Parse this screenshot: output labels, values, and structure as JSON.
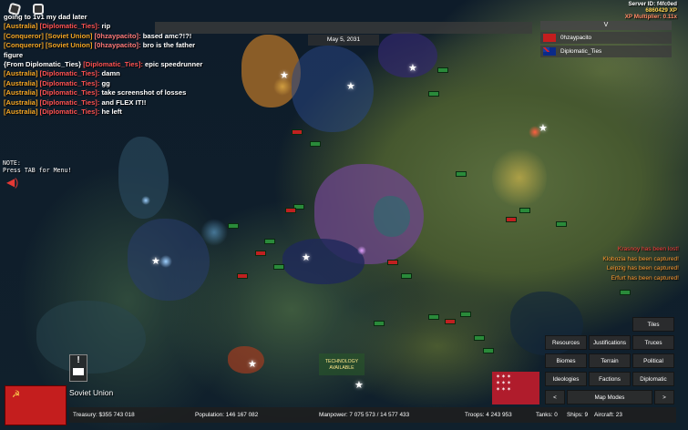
{
  "chat": [
    {
      "segments": [
        {
          "t": "going to 1v1 my dad later",
          "c": "tag-from"
        }
      ]
    },
    {
      "segments": [
        {
          "t": "[Australia] ",
          "c": "tag-au"
        },
        {
          "t": "[Diplomatic_Ties]:",
          "c": "tag-dt"
        },
        {
          "t": "  rip",
          "c": "tag-from"
        }
      ]
    },
    {
      "segments": [
        {
          "t": "[Conqueror] [Soviet Union] ",
          "c": "tag-cq"
        },
        {
          "t": "[0hzaypacito]:",
          "c": "tag-oz"
        },
        {
          "t": "  based amc?!?!",
          "c": "tag-from"
        }
      ]
    },
    {
      "segments": [
        {
          "t": "[Conqueror] [Soviet Union] ",
          "c": "tag-cq"
        },
        {
          "t": "[0hzaypacito]:",
          "c": "tag-oz"
        },
        {
          "t": "  bro is the father",
          "c": "tag-from"
        }
      ]
    },
    {
      "segments": [
        {
          "t": "figure",
          "c": "tag-from"
        }
      ]
    },
    {
      "segments": [
        {
          "t": "{From Diplomatic_Ties} ",
          "c": "tag-from"
        },
        {
          "t": "[Diplomatic_Ties]:",
          "c": "tag-dt"
        },
        {
          "t": "  epic speedrunner",
          "c": "tag-from"
        }
      ]
    },
    {
      "segments": [
        {
          "t": "[Australia] ",
          "c": "tag-au"
        },
        {
          "t": "[Diplomatic_Ties]:",
          "c": "tag-dt"
        },
        {
          "t": "  damn",
          "c": "tag-from"
        }
      ]
    },
    {
      "segments": [
        {
          "t": "[Australia] ",
          "c": "tag-au"
        },
        {
          "t": "[Diplomatic_Ties]:",
          "c": "tag-dt"
        },
        {
          "t": "  gg",
          "c": "tag-from"
        }
      ]
    },
    {
      "segments": [
        {
          "t": "[Australia] ",
          "c": "tag-au"
        },
        {
          "t": "[Diplomatic_Ties]:",
          "c": "tag-dt"
        },
        {
          "t": "  take screenshot of losses",
          "c": "tag-from"
        }
      ]
    },
    {
      "segments": [
        {
          "t": "[Australia] ",
          "c": "tag-au"
        },
        {
          "t": "[Diplomatic_Ties]:",
          "c": "tag-dt"
        },
        {
          "t": "  and FLEX IT!!",
          "c": "tag-from"
        }
      ]
    },
    {
      "segments": [
        {
          "t": "[Australia] ",
          "c": "tag-au"
        },
        {
          "t": "[Diplomatic_Ties]:",
          "c": "tag-dt"
        },
        {
          "t": "  he left",
          "c": "tag-from"
        }
      ]
    }
  ],
  "note": {
    "line1": "NOTE:",
    "line2": "Press TAB for Menu!"
  },
  "date": "May 5, 2031",
  "server": {
    "id": "Server ID: f4fc0ed",
    "xp": "6860429 XP",
    "multiplier": "XP Multiplier: 0.11x"
  },
  "player_list": {
    "toggle": "V",
    "players": [
      {
        "name": "0hzaypacito",
        "flag": "flag-su"
      },
      {
        "name": "Diplomatic_Ties",
        "flag": "flag-au"
      }
    ]
  },
  "notifications": [
    {
      "text": "Krasnoy has been lost!",
      "color": "n-red"
    },
    {
      "text": "Klobozia has been captured!",
      "color": "n-org"
    },
    {
      "text": "Leipzig has been captured!",
      "color": "n-org"
    },
    {
      "text": "Erfurt has been captured!",
      "color": "n-org"
    }
  ],
  "tech": {
    "line1": "TECHNOLOGY",
    "line2": "AVAILABLE"
  },
  "alert": {
    "mark": "!"
  },
  "country": {
    "name": "Soviet Union"
  },
  "stats": {
    "treasury": "Treasury:  $355 743 018",
    "population": "Population: 146 167 082",
    "manpower": "Manpower:  7 075 573  /  14 577 433",
    "troops": "Troops: 4 243 953",
    "tanks": "Tanks: 0",
    "ships": "Ships: 9",
    "aircraft": "Aircraft: 23"
  },
  "map_modes": {
    "tiles": "Tiles",
    "resources": "Resources",
    "justifications": "Justifications",
    "truces": "Truces",
    "biomes": "Biomes",
    "terrain": "Terrain",
    "political": "Political",
    "ideologies": "Ideologies",
    "factions": "Factions",
    "diplomatic": "Diplomatic",
    "prev": "<",
    "label": "Map Modes",
    "next": ">"
  },
  "colors": {
    "soviet_red": "#c41e1e",
    "green_unit": "#2a8a3a",
    "notif_orange": "#ff9a30",
    "notif_red": "#ff3b3b"
  }
}
